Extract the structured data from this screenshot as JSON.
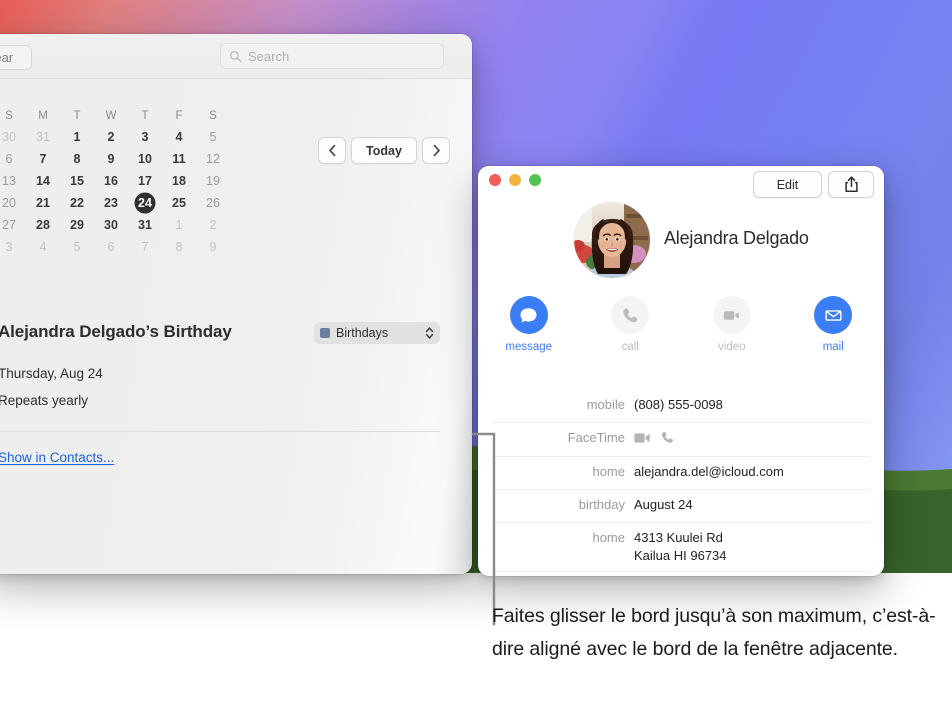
{
  "wallpaper": {
    "gradient_from": "#e75c55",
    "gradient_mid": "#8c7bf0",
    "gradient_to": "#8ea4fb",
    "hill_color": "#37642a",
    "hill_color_light": "#4a7a33"
  },
  "calendar_window": {
    "toolbar": {
      "year_button": "Year",
      "search_placeholder": "Search",
      "search_icon": "search-icon"
    },
    "nav": {
      "prev_label": "‹",
      "today_label": "Today",
      "next_label": "›"
    },
    "month": {
      "day_headers": [
        "S",
        "M",
        "T",
        "W",
        "T",
        "F",
        "S"
      ],
      "weeks": [
        [
          {
            "d": "30",
            "state": "muted"
          },
          {
            "d": "31",
            "state": "muted"
          },
          {
            "d": "1",
            "state": "normal"
          },
          {
            "d": "2",
            "state": "normal"
          },
          {
            "d": "3",
            "state": "normal"
          },
          {
            "d": "4",
            "state": "normal"
          },
          {
            "d": "5",
            "state": "weekend"
          }
        ],
        [
          {
            "d": "6",
            "state": "weekend"
          },
          {
            "d": "7",
            "state": "normal"
          },
          {
            "d": "8",
            "state": "normal"
          },
          {
            "d": "9",
            "state": "normal"
          },
          {
            "d": "10",
            "state": "normal"
          },
          {
            "d": "11",
            "state": "normal"
          },
          {
            "d": "12",
            "state": "weekend"
          }
        ],
        [
          {
            "d": "13",
            "state": "weekend"
          },
          {
            "d": "14",
            "state": "normal"
          },
          {
            "d": "15",
            "state": "normal"
          },
          {
            "d": "16",
            "state": "normal"
          },
          {
            "d": "17",
            "state": "normal"
          },
          {
            "d": "18",
            "state": "normal"
          },
          {
            "d": "19",
            "state": "weekend"
          }
        ],
        [
          {
            "d": "20",
            "state": "weekend"
          },
          {
            "d": "21",
            "state": "normal"
          },
          {
            "d": "22",
            "state": "normal"
          },
          {
            "d": "23",
            "state": "normal"
          },
          {
            "d": "24",
            "state": "today"
          },
          {
            "d": "25",
            "state": "normal"
          },
          {
            "d": "26",
            "state": "weekend"
          }
        ],
        [
          {
            "d": "27",
            "state": "weekend"
          },
          {
            "d": "28",
            "state": "normal"
          },
          {
            "d": "29",
            "state": "normal"
          },
          {
            "d": "30",
            "state": "normal"
          },
          {
            "d": "31",
            "state": "normal"
          },
          {
            "d": "1",
            "state": "muted"
          },
          {
            "d": "2",
            "state": "muted"
          }
        ],
        [
          {
            "d": "3",
            "state": "muted"
          },
          {
            "d": "4",
            "state": "muted"
          },
          {
            "d": "5",
            "state": "muted"
          },
          {
            "d": "6",
            "state": "muted"
          },
          {
            "d": "7",
            "state": "muted"
          },
          {
            "d": "8",
            "state": "muted"
          },
          {
            "d": "9",
            "state": "muted"
          }
        ]
      ]
    },
    "event": {
      "title": "Alejandra Delgado’s Birthday",
      "calendar_name": "Birthdays",
      "calendar_color": "#6b7f9e",
      "date": "Thursday, Aug 24",
      "repeat": "Repeats yearly",
      "link": "Show in Contacts..."
    }
  },
  "contact_card": {
    "edit_label": "Edit",
    "share_icon": "share-icon",
    "name": "Alejandra Delgado",
    "avatar_alt": "Alejandra Delgado photo",
    "accent_color": "#3b7df5",
    "actions": [
      {
        "label": "message",
        "icon": "message-bubble-icon",
        "enabled": true
      },
      {
        "label": "call",
        "icon": "phone-icon",
        "enabled": false
      },
      {
        "label": "video",
        "icon": "video-camera-icon",
        "enabled": false
      },
      {
        "label": "mail",
        "icon": "envelope-icon",
        "enabled": true
      }
    ],
    "fields": [
      {
        "label": "mobile",
        "value": "(808) 555-0098",
        "type": "text"
      },
      {
        "label": "FaceTime",
        "value": "",
        "type": "icons"
      },
      {
        "label": "home",
        "value": "alejandra.del@icloud.com",
        "type": "text"
      },
      {
        "label": "birthday",
        "value": "August 24",
        "type": "text"
      },
      {
        "label": "home",
        "value": "4313 Kuulei Rd",
        "value2": "Kailua HI 96734",
        "type": "text2"
      }
    ]
  },
  "callout": {
    "caption": "Faites glisser le bord jusqu’à son maximum, c’est-à-dire aligné avec le bord de la fenêtre adjacente.",
    "line_color": "#8a8a8a"
  }
}
